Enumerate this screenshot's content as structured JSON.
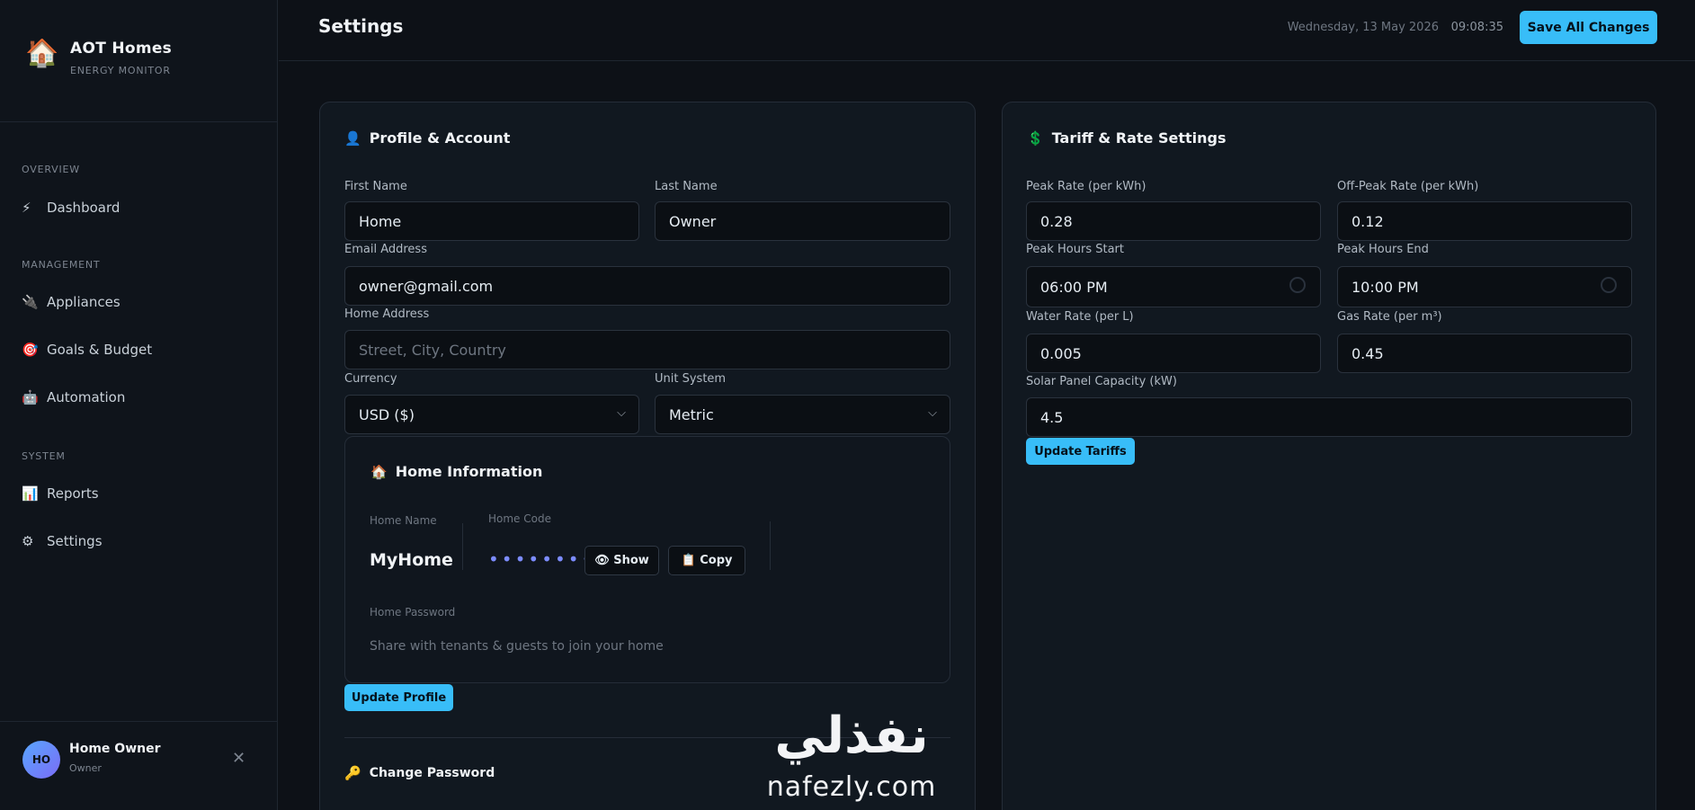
{
  "brand": {
    "icon": "house-icon",
    "name": "AOT Homes",
    "subtitle": "ENERGY MONITOR"
  },
  "nav": {
    "sections": [
      {
        "label": "OVERVIEW"
      },
      {
        "label": "MANAGEMENT"
      },
      {
        "label": "SYSTEM"
      }
    ],
    "items": [
      {
        "label": "Dashboard",
        "icon": "lightning-icon",
        "glyph": "⚡"
      },
      {
        "label": "Appliances",
        "icon": "plug-icon",
        "glyph": "🔌"
      },
      {
        "label": "Goals & Budget",
        "icon": "target-icon",
        "glyph": "🎯"
      },
      {
        "label": "Automation",
        "icon": "robot-icon",
        "glyph": "🤖"
      },
      {
        "label": "Reports",
        "icon": "bar-chart-icon",
        "glyph": "📊"
      },
      {
        "label": "Settings",
        "icon": "gear-icon",
        "glyph": "⚙"
      }
    ]
  },
  "user": {
    "initials": "HO",
    "name": "Home Owner",
    "role": "Owner",
    "close_glyph": "✕"
  },
  "header": {
    "title": "Settings",
    "date": "Wednesday, 13 May 2026",
    "time": "09:08:35",
    "save_label": "Save All Changes"
  },
  "profile": {
    "title": "Profile & Account",
    "icon_glyph": "👤",
    "first_name_label": "First Name",
    "first_name": "Home",
    "last_name_label": "Last Name",
    "last_name": "Owner",
    "email_label": "Email Address",
    "email": "owner@gmail.com",
    "address_label": "Home Address",
    "address_placeholder": "Street, City, Country",
    "currency_label": "Currency",
    "currency": "USD ($)",
    "unit_label": "Unit System",
    "unit": "Metric",
    "update_label": "Update Profile"
  },
  "home_info": {
    "title": "Home Information",
    "icon_glyph": "🏠",
    "home_name_label": "Home Name",
    "home_name": "MyHome",
    "home_code_label": "Home Code",
    "home_code_masked": "••••••••",
    "show_label": "👁 Show",
    "copy_label": "📋 Copy",
    "home_password_label": "Home Password",
    "password_hint": "Share with tenants & guests to join your home"
  },
  "change_password": {
    "title": "Change Password",
    "icon_glyph": "🔑"
  },
  "tariff": {
    "title": "Tariff & Rate Settings",
    "icon_glyph": "💲",
    "peak_rate_label": "Peak Rate (per kWh)",
    "peak_rate": "0.28",
    "offpeak_rate_label": "Off-Peak Rate (per kWh)",
    "offpeak_rate": "0.12",
    "peak_start_label": "Peak Hours Start",
    "peak_start": "06:00  PM",
    "peak_end_label": "Peak Hours End",
    "peak_end": "10:00  PM",
    "water_rate_label": "Water Rate (per L)",
    "water_rate": "0.005",
    "gas_rate_label": "Gas Rate (per m³)",
    "gas_rate": "0.45",
    "solar_label": "Solar Panel Capacity (kW)",
    "solar": "4.5",
    "update_label": "Update Tariffs"
  },
  "watermark": {
    "arabic": "نفذلي",
    "latin": "nafezly.com"
  },
  "icons": {
    "chevron": "chevron-down-icon",
    "clock": "clock-icon"
  },
  "colors": {
    "accent": "#38bdf8",
    "background": "#0d1117",
    "card": "#111820",
    "masked_dots": "#7c8cff"
  }
}
